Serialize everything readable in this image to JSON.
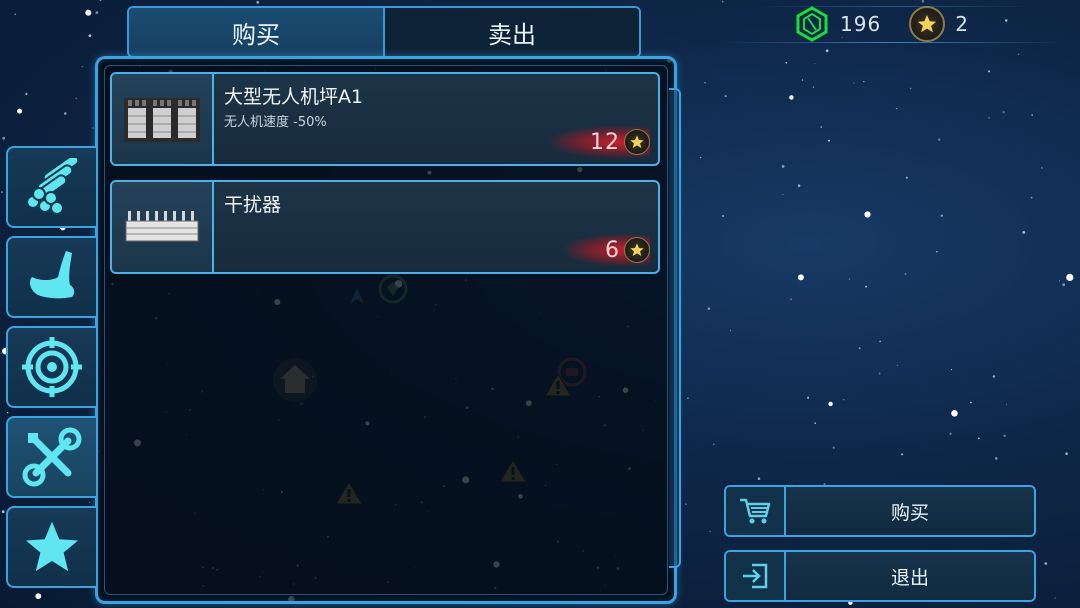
{
  "currencies": {
    "gems": {
      "value": "196",
      "icon": "green-gem-icon",
      "color": "#1ddc3a"
    },
    "stars": {
      "value": "2",
      "icon": "star-coin-icon",
      "color": "#e9c74a"
    }
  },
  "tabs": [
    {
      "label": "购买",
      "active": true
    },
    {
      "label": "卖出",
      "active": false
    }
  ],
  "categories": [
    {
      "icon": "pipes-icon",
      "active": false
    },
    {
      "icon": "claw-icon",
      "active": false
    },
    {
      "icon": "target-icon",
      "active": false
    },
    {
      "icon": "tools-icon",
      "active": true
    },
    {
      "icon": "star-icon",
      "active": false
    }
  ],
  "items": [
    {
      "name": "大型无人机坪A1",
      "description": "无人机速度 -50%",
      "price": "12",
      "icon": "drone-pad-icon"
    },
    {
      "name": "干扰器",
      "description": "",
      "price": "6",
      "icon": "jammer-icon"
    }
  ],
  "actions": {
    "buy_label": "购买",
    "exit_label": "退出"
  },
  "colors": {
    "accent": "#3aa3e0",
    "price_glow": "#e61e28",
    "background": "#0e2647"
  }
}
